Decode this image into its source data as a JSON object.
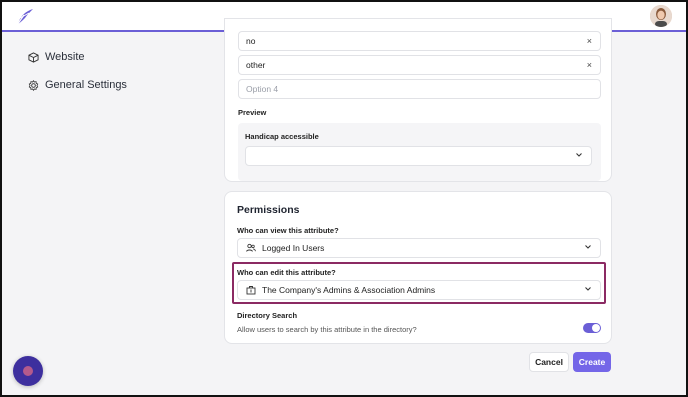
{
  "sidebar": {
    "items": [
      {
        "label": "Website",
        "icon": "cube-icon"
      },
      {
        "label": "General Settings",
        "icon": "gear-icon"
      }
    ]
  },
  "options": {
    "items": [
      {
        "value": "no"
      },
      {
        "value": "other"
      }
    ],
    "new_placeholder": "Option 4"
  },
  "preview": {
    "heading": "Preview",
    "field_label": "Handicap accessible",
    "select_value": ""
  },
  "permissions": {
    "title": "Permissions",
    "view_label": "Who can view this attribute?",
    "view_value": "Logged In Users",
    "edit_label": "Who can edit this attribute?",
    "edit_value": "The Company's Admins & Association Admins",
    "directory_label": "Directory Search",
    "directory_help": "Allow users to search by this attribute in the directory?",
    "directory_enabled": true
  },
  "actions": {
    "cancel_label": "Cancel",
    "create_label": "Create"
  },
  "colors": {
    "accent": "#7466e8",
    "highlight": "#8b2a63",
    "topbar_border": "#6b5fd6"
  }
}
